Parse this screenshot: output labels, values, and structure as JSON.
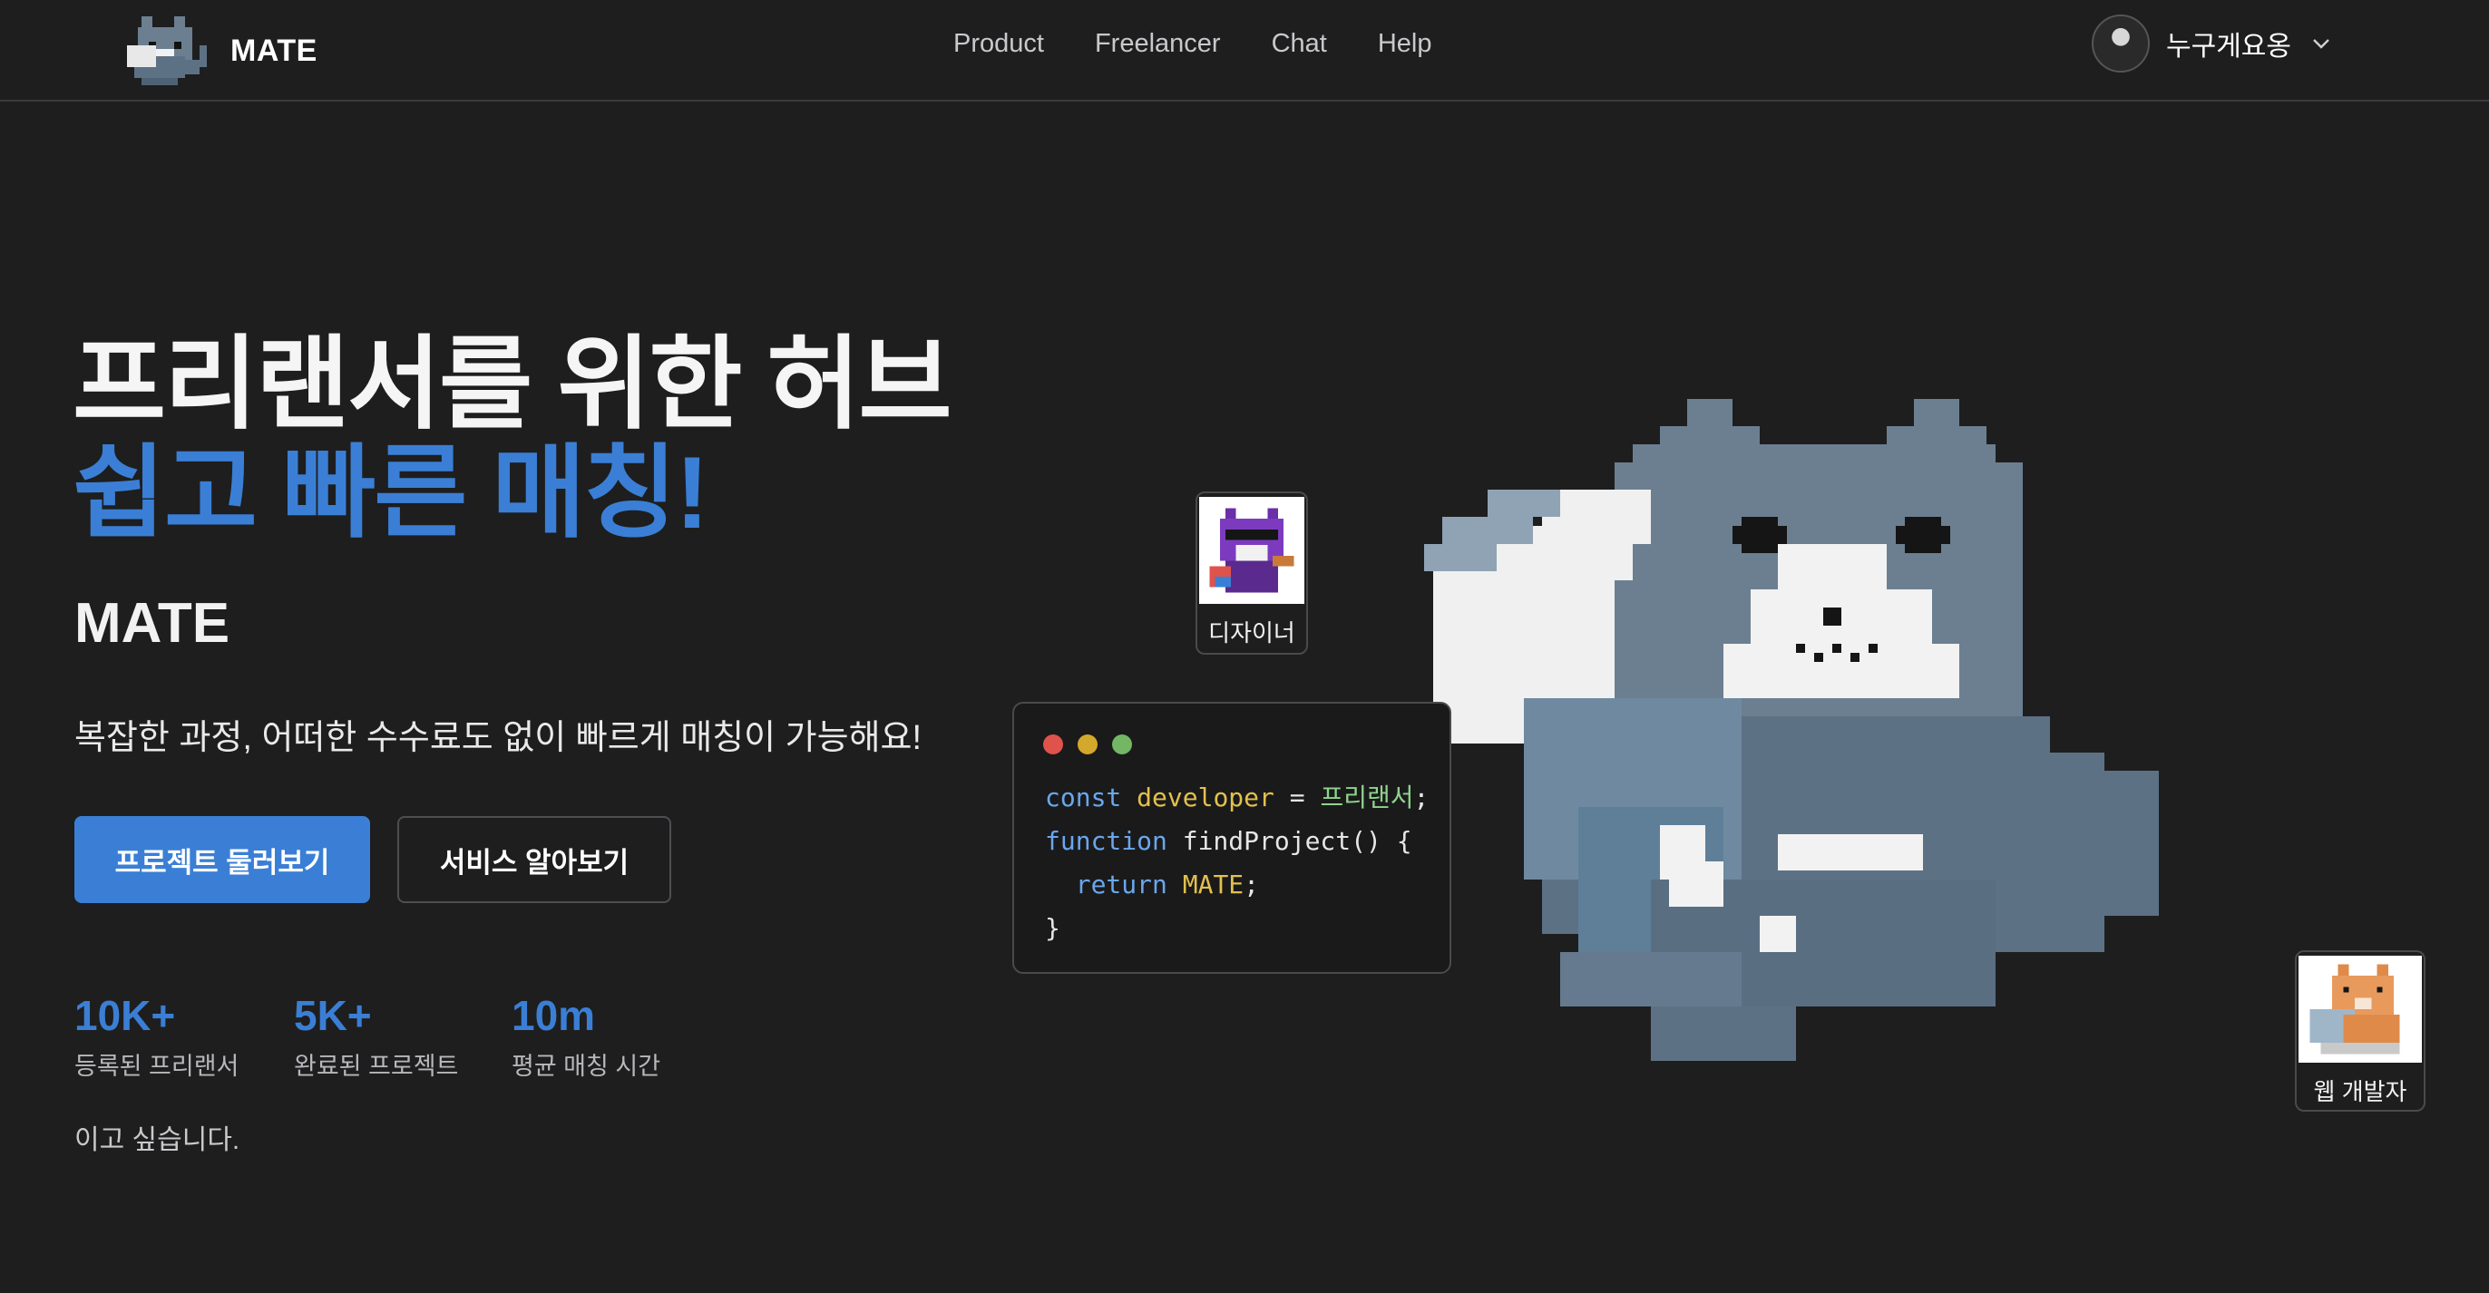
{
  "header": {
    "brand": "MATE",
    "nav": [
      "Product",
      "Freelancer",
      "Chat",
      "Help"
    ],
    "user_name": "누구게요옹"
  },
  "hero": {
    "title": "프리랜서를 위한 허브",
    "subtitle": "쉽고 빠른 매칭!",
    "brand": "MATE",
    "description": "복잡한 과정, 어떠한 수수료도 없이 빠르게 매칭이 가능해요!",
    "primary_button": "프로젝트 둘러보기",
    "secondary_button": "서비스 알아보기"
  },
  "stats": [
    {
      "value": "10K+",
      "label": "등록된 프리랜서"
    },
    {
      "value": "5K+",
      "label": "완료된 프로젝트"
    },
    {
      "value": "10m",
      "label": "평균 매칭 시간"
    }
  ],
  "footnote": "이고 싶습니다.",
  "cards": {
    "designer_label": "디자이너",
    "webdev_label": "웹 개발자"
  },
  "code": {
    "l1_kw": "const",
    "l1_id": "developer",
    "l1_op": " = ",
    "l1_str": "프리랜서",
    "l1_end": ";",
    "l2_kw": "function",
    "l2_rest": " findProject() {",
    "l3_kw": "return",
    "l3_id": "MATE",
    "l3_end": ";",
    "l4": "}"
  },
  "colors": {
    "background": "#1e1e1f",
    "accent": "#3a7fd5",
    "text": "#ffffff",
    "muted": "#b8b8bc"
  },
  "icons": [
    "mate-cat-logo",
    "chevron-down-icon",
    "user-avatar",
    "window-dots",
    "pixel-cat-illustration"
  ]
}
